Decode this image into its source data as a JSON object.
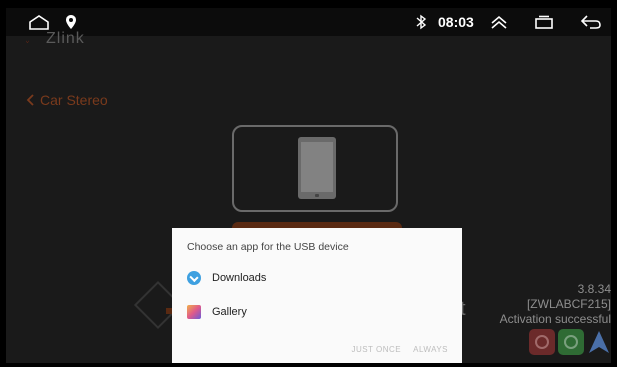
{
  "status_bar": {
    "time": "08:03",
    "icons": [
      "home-icon",
      "location-icon",
      "bluetooth-icon",
      "expand-up-icon",
      "recent-apps-icon",
      "back-icon"
    ]
  },
  "app": {
    "logo": "Zlink",
    "back_label": "Car Stereo",
    "partial_text": "t",
    "version": "3.8.34",
    "device_id": "[ZWLABCF215]",
    "activation_status": "Activation successful",
    "accent_color": "#e05a1c"
  },
  "dialog": {
    "title": "Choose an app for the USB device",
    "options": [
      {
        "label": "Downloads",
        "icon": "downloads-icon"
      },
      {
        "label": "Gallery",
        "icon": "gallery-icon"
      }
    ],
    "just_once": "JUST ONCE",
    "always": "ALWAYS"
  }
}
